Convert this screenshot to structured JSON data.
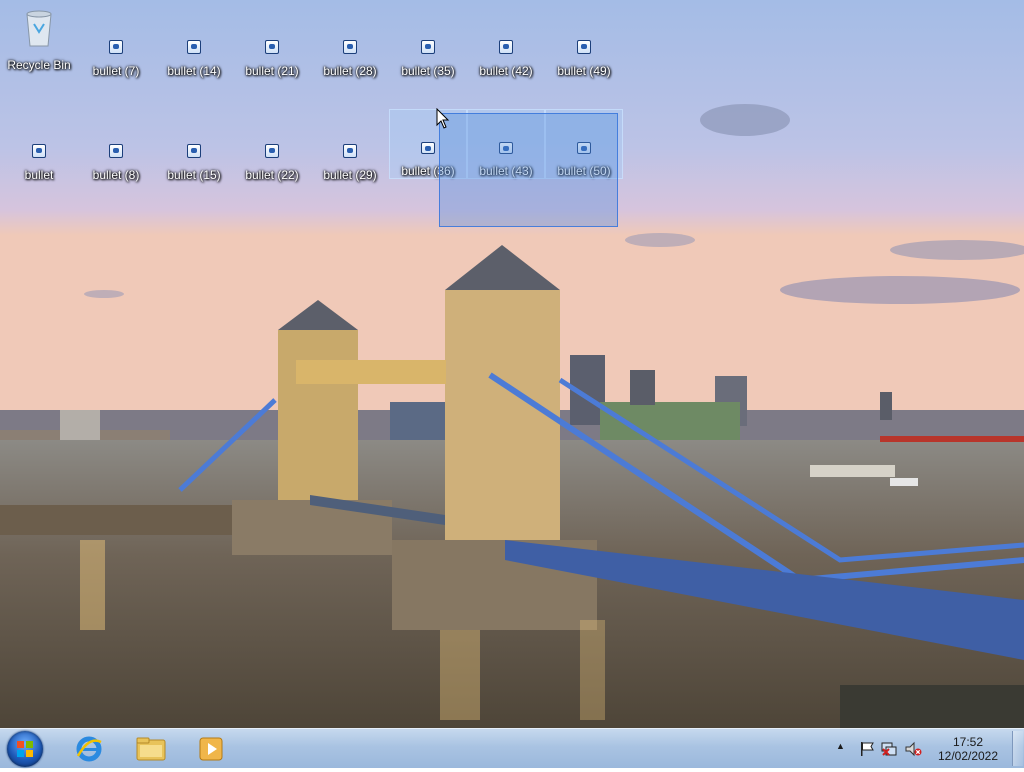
{
  "desktop": {
    "icons": [
      {
        "label": "Recycle Bin",
        "icon": "recycle-bin-icon"
      },
      {
        "label": "bullet (7)",
        "icon": "file-icon"
      },
      {
        "label": "bullet (14)",
        "icon": "file-icon"
      },
      {
        "label": "bullet (21)",
        "icon": "file-icon"
      },
      {
        "label": "bullet (28)",
        "icon": "file-icon"
      },
      {
        "label": "bullet (35)",
        "icon": "file-icon"
      },
      {
        "label": "bullet (42)",
        "icon": "file-icon"
      },
      {
        "label": "bullet (49)",
        "icon": "file-icon"
      },
      {
        "label": "bullet",
        "icon": "file-icon"
      },
      {
        "label": "bullet (8)",
        "icon": "file-icon"
      },
      {
        "label": "bullet (15)",
        "icon": "file-icon"
      },
      {
        "label": "bullet (22)",
        "icon": "file-icon"
      },
      {
        "label": "bullet (29)",
        "icon": "file-icon"
      },
      {
        "label": "bullet (36)",
        "icon": "file-icon"
      },
      {
        "label": "bullet (43)",
        "icon": "file-icon"
      },
      {
        "label": "bullet (50)",
        "icon": "file-icon"
      }
    ]
  },
  "taskbar": {
    "pinned": [
      {
        "name": "internet-explorer",
        "icon": "internet-explorer-icon"
      },
      {
        "name": "file-explorer",
        "icon": "folder-icon"
      },
      {
        "name": "media-player",
        "icon": "media-player-icon"
      }
    ],
    "tray_icons": [
      "show-hidden-icons-arrow",
      "action-center-flag-icon",
      "network-icon",
      "volume-muted-icon"
    ],
    "clock": {
      "time": "17:52",
      "date": "12/02/2022"
    }
  },
  "colors": {
    "taskbar": "#a9c3e2",
    "selection": "#3c78dc"
  }
}
